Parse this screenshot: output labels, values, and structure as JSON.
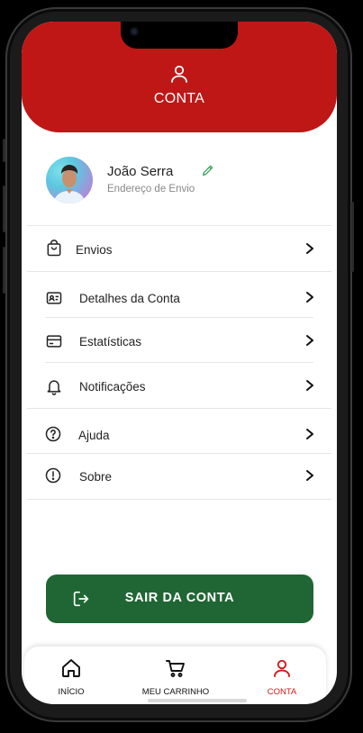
{
  "header": {
    "title": "CONTA",
    "icon": "user-icon"
  },
  "profile": {
    "name": "João Serra",
    "subtitle": "Endereço de Envio"
  },
  "menu": {
    "items": [
      {
        "label": "Envios",
        "icon": "bag-icon"
      },
      {
        "label": "Detalhes da Conta",
        "icon": "id-card-icon"
      },
      {
        "label": "Estatísticas",
        "icon": "card-icon"
      },
      {
        "label": "Notificações",
        "icon": "bell-icon"
      },
      {
        "label": "Ajuda",
        "icon": "help-circle-icon"
      },
      {
        "label": "Sobre",
        "icon": "info-circle-icon"
      }
    ]
  },
  "logout": {
    "label": "SAIR DA CONTA"
  },
  "nav": {
    "items": [
      {
        "label": "INÍCIO",
        "icon": "home-icon"
      },
      {
        "label": "MEU CARRINHO",
        "icon": "cart-icon"
      },
      {
        "label": "CONTA",
        "icon": "user-icon"
      }
    ],
    "active": "CONTA"
  },
  "colors": {
    "primary_red": "#bf1716",
    "logout_green": "#1f6634",
    "active_nav": "#d11a1a",
    "edit_green": "#3aa55a"
  }
}
